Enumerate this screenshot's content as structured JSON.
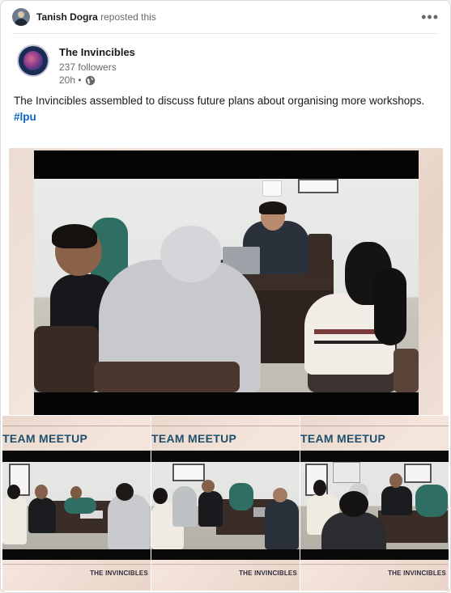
{
  "repost": {
    "name": "Tanish Dogra",
    "action": "reposted this",
    "more_icon": "ellipsis-horizontal-icon"
  },
  "author": {
    "name": "The Invincibles",
    "followers": "237 followers",
    "time": "20h •",
    "visibility_icon": "globe-icon"
  },
  "post": {
    "text": "The Invincibles assembled to discuss future plans about organising more workshops.",
    "hashtag": "#lpu"
  },
  "thumbnails": [
    {
      "title": "TEAM MEETUP",
      "footer": "THE INVINCIBLES"
    },
    {
      "title": "TEAM MEETUP",
      "footer": "THE INVINCIBLES"
    },
    {
      "title": "TEAM MEETUP",
      "footer": "THE INVINCIBLES"
    }
  ],
  "colors": {
    "link": "#0a66c2",
    "banner_title": "#1f4f6c",
    "background_pink": "#ecdcd2"
  }
}
